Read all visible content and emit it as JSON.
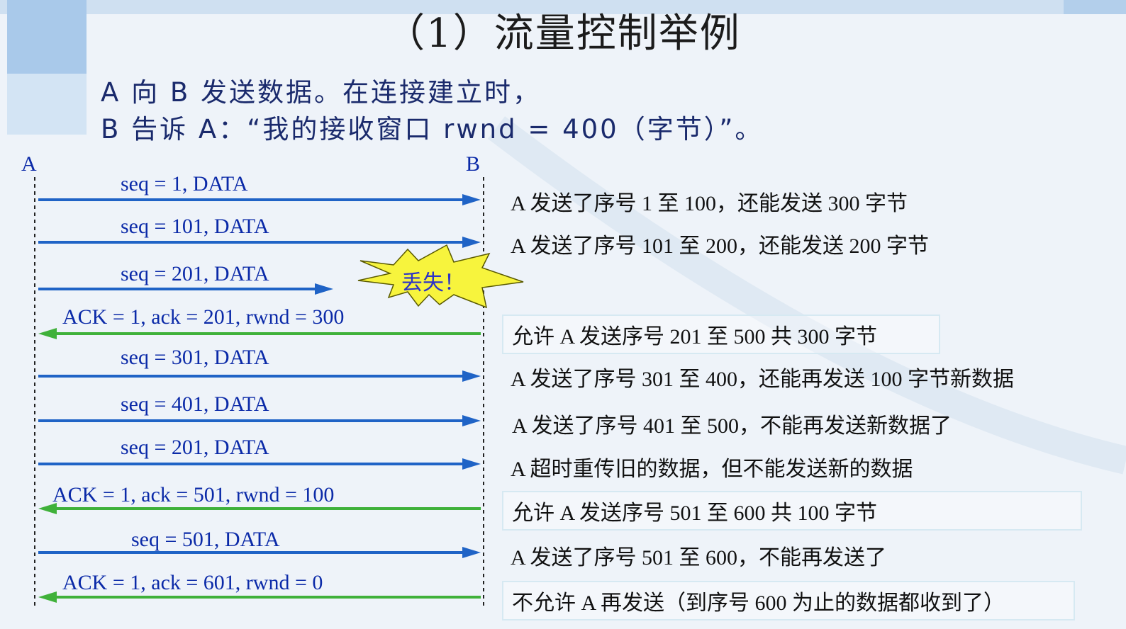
{
  "title": "（1）流量控制举例",
  "intro": {
    "line1": "A 向 B 发送数据。在连接建立时，",
    "line2": "B 告诉 A：“我的接收窗口 rwnd = 400（字节）”。"
  },
  "endpoints": {
    "a": "A",
    "b": "B"
  },
  "lost_label": "丢失！",
  "messages": [
    {
      "label": "seq = 1, DATA",
      "direction": "A→B",
      "color": "#1f63c6",
      "lost": false
    },
    {
      "label": "seq = 101, DATA",
      "direction": "A→B",
      "color": "#1f63c6",
      "lost": false
    },
    {
      "label": "seq = 201, DATA",
      "direction": "A→B",
      "color": "#1f63c6",
      "lost": true
    },
    {
      "label": "ACK = 1, ack = 201, rwnd = 300",
      "direction": "B→A",
      "color": "#3fb13a",
      "lost": false
    },
    {
      "label": "seq = 301, DATA",
      "direction": "A→B",
      "color": "#1f63c6",
      "lost": false
    },
    {
      "label": "seq = 401, DATA",
      "direction": "A→B",
      "color": "#1f63c6",
      "lost": false
    },
    {
      "label": "seq = 201, DATA",
      "direction": "A→B",
      "color": "#1f63c6",
      "lost": false
    },
    {
      "label": "ACK = 1, ack = 501, rwnd = 100",
      "direction": "B→A",
      "color": "#3fb13a",
      "lost": false
    },
    {
      "label": "seq = 501, DATA",
      "direction": "A→B",
      "color": "#1f63c6",
      "lost": false
    },
    {
      "label": "ACK = 1, ack = 601, rwnd = 0",
      "direction": "B→A",
      "color": "#3fb13a",
      "lost": false
    }
  ],
  "notes": [
    "A 发送了序号 1 至 100，还能发送 300 字节",
    "A 发送了序号 101 至 200，还能发送 200 字节",
    "允许 A 发送序号 201 至 500 共 300 字节",
    "A 发送了序号 301 至 400，还能再发送 100 字节新数据",
    "A 发送了序号 401 至 500，不能再发送新数据了",
    "A 超时重传旧的数据，但不能发送新的数据",
    "允许 A 发送序号 501 至 600 共 100 字节",
    "A 发送了序号 501 至 600，不能再发送了",
    "不允许 A 再发送（到序号 600 为止的数据都收到了）"
  ]
}
